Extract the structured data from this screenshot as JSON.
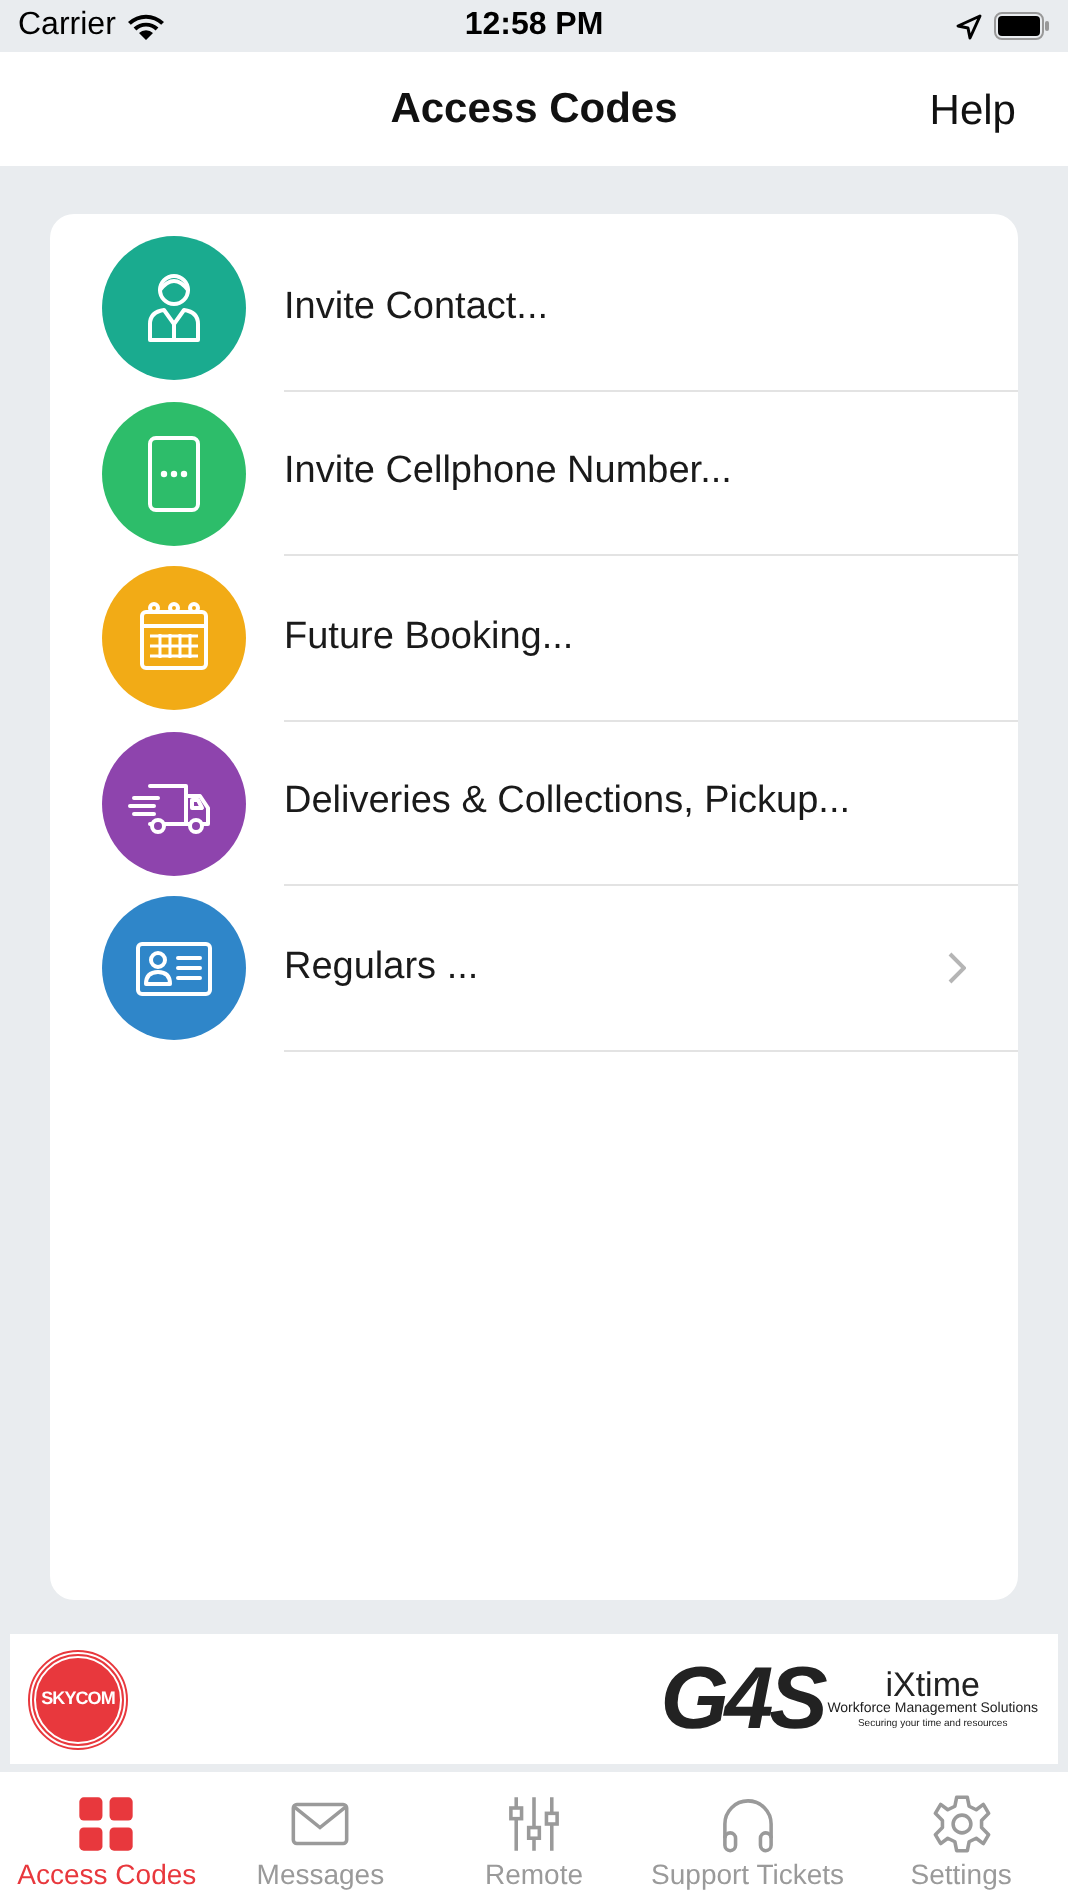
{
  "status_bar": {
    "carrier": "Carrier",
    "time": "12:58 PM"
  },
  "nav_bar": {
    "title": "Access Codes",
    "action": "Help"
  },
  "menu_items": [
    {
      "label": "Invite Contact...",
      "kind": "person",
      "color": "#1aab8f",
      "chevron": false
    },
    {
      "label": "Invite Cellphone Number...",
      "kind": "phone",
      "color": "#2dbd6a",
      "chevron": false
    },
    {
      "label": "Future Booking...",
      "kind": "calendar",
      "color": "#f2ab16",
      "chevron": false
    },
    {
      "label": "Deliveries & Collections, Pickup...",
      "kind": "truck",
      "color": "#8e44ad",
      "chevron": false
    },
    {
      "label": "Regulars ...",
      "kind": "card",
      "color": "#2f86c9",
      "chevron": true
    }
  ],
  "footer_banner": {
    "left_logo": "SKYCOM",
    "right_logo": {
      "mark": "G4S",
      "brand": "iXtime",
      "tagline": "Workforce Management Solutions",
      "slogan": "Securing your time and resources"
    }
  },
  "tab_bar": [
    {
      "label": "Access Codes",
      "kind": "grid",
      "selected": true
    },
    {
      "label": "Messages",
      "kind": "mail",
      "selected": false
    },
    {
      "label": "Remote",
      "kind": "sliders",
      "selected": false
    },
    {
      "label": "Support Tickets",
      "kind": "headset",
      "selected": false
    },
    {
      "label": "Settings",
      "kind": "gear",
      "selected": false
    }
  ]
}
